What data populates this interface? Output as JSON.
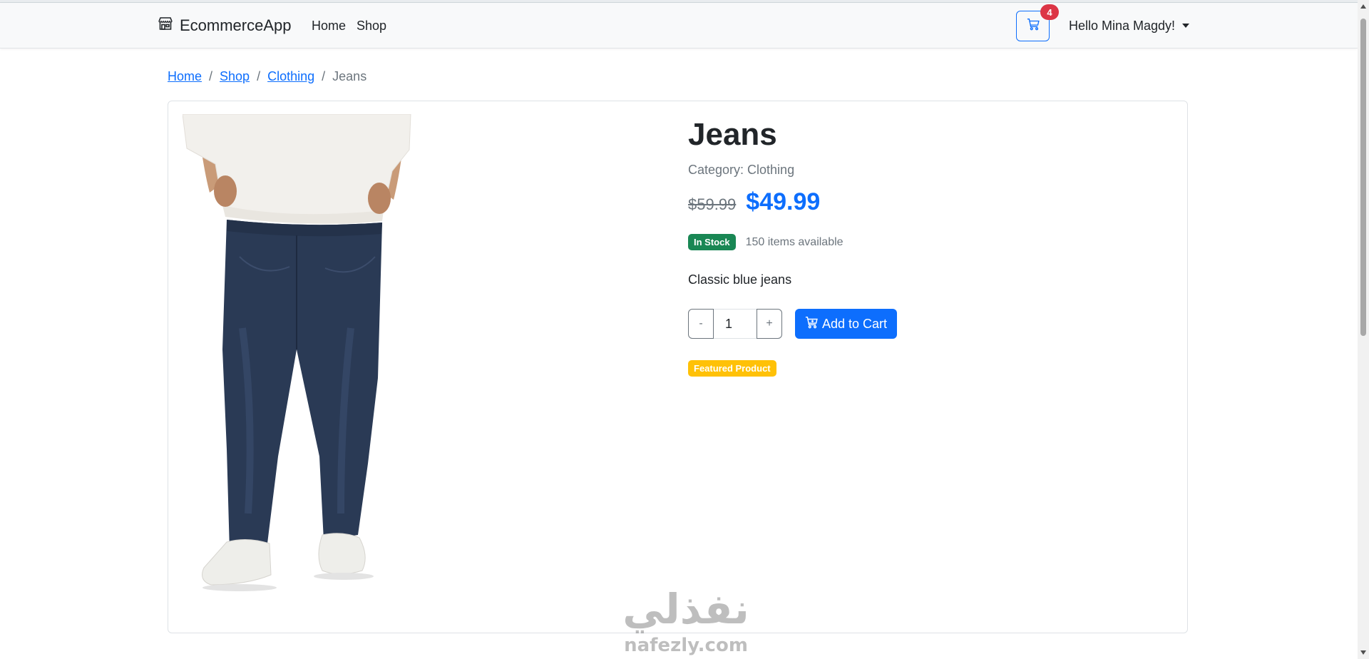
{
  "navbar": {
    "brand": "EcommerceApp",
    "links": [
      "Home",
      "Shop"
    ],
    "cart_count": "4",
    "greeting": "Hello Mina Magdy!"
  },
  "breadcrumb": {
    "items": [
      "Home",
      "Shop",
      "Clothing"
    ],
    "separator": "/",
    "current": "Jeans"
  },
  "product": {
    "title": "Jeans",
    "category": "Category: Clothing",
    "old_price": "$59.99",
    "price": "$49.99",
    "stock_badge": "In Stock",
    "available": "150 items available",
    "description": "Classic blue jeans",
    "quantity": "1",
    "minus_label": "-",
    "plus_label": "+",
    "add_to_cart": "Add to Cart",
    "featured_badge": "Featured Product"
  },
  "watermark": {
    "arabic": "نفذلي",
    "latin": "nafezly.com"
  },
  "colors": {
    "primary": "#0d6efd",
    "success": "#198754",
    "warning": "#ffc107",
    "danger": "#dc3545",
    "muted": "#6c757d"
  }
}
